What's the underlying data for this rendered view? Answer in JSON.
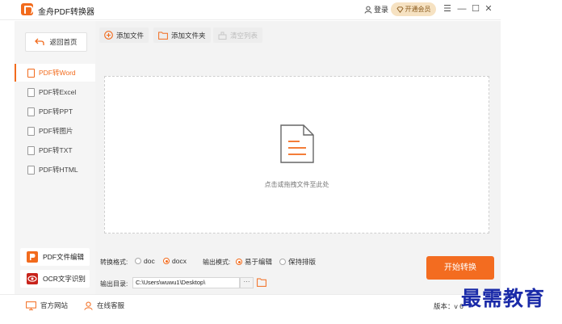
{
  "app": {
    "title": "金舟PDF转换器",
    "brand_color": "#f26b1d"
  },
  "header": {
    "login_label": "登录",
    "vip_label": "开通会员"
  },
  "sidebar": {
    "back_label": "返回首页",
    "items": [
      {
        "label": "PDF转Word",
        "active": true
      },
      {
        "label": "PDF转Excel",
        "active": false
      },
      {
        "label": "PDF转PPT",
        "active": false
      },
      {
        "label": "PDF转图片",
        "active": false
      },
      {
        "label": "PDF转TXT",
        "active": false
      },
      {
        "label": "PDF转HTML",
        "active": false
      }
    ],
    "cards": [
      {
        "label": "PDF文件编辑",
        "icon": "pdf-edit-icon"
      },
      {
        "label": "OCR文字识别",
        "icon": "ocr-icon"
      }
    ]
  },
  "toolbar": {
    "add_file": "添加文件",
    "add_folder": "添加文件夹",
    "clear_list": "清空列表"
  },
  "dropzone": {
    "hint": "点击或拖拽文件至此处"
  },
  "options": {
    "format_label": "转换格式:",
    "formats": [
      {
        "label": "doc",
        "selected": false
      },
      {
        "label": "docx",
        "selected": true
      }
    ],
    "mode_label": "输出模式:",
    "modes": [
      {
        "label": "易于编辑",
        "selected": true
      },
      {
        "label": "保持排版",
        "selected": false
      }
    ],
    "dir_label": "输出目录:",
    "dir_value": "C:\\Users\\wuwu1\\Desktop\\",
    "browse_label": "···",
    "start_label": "开始转换"
  },
  "statusbar": {
    "website": "官方网站",
    "support": "在线客服",
    "version": "版本：v 6"
  },
  "watermark": "最需教育"
}
